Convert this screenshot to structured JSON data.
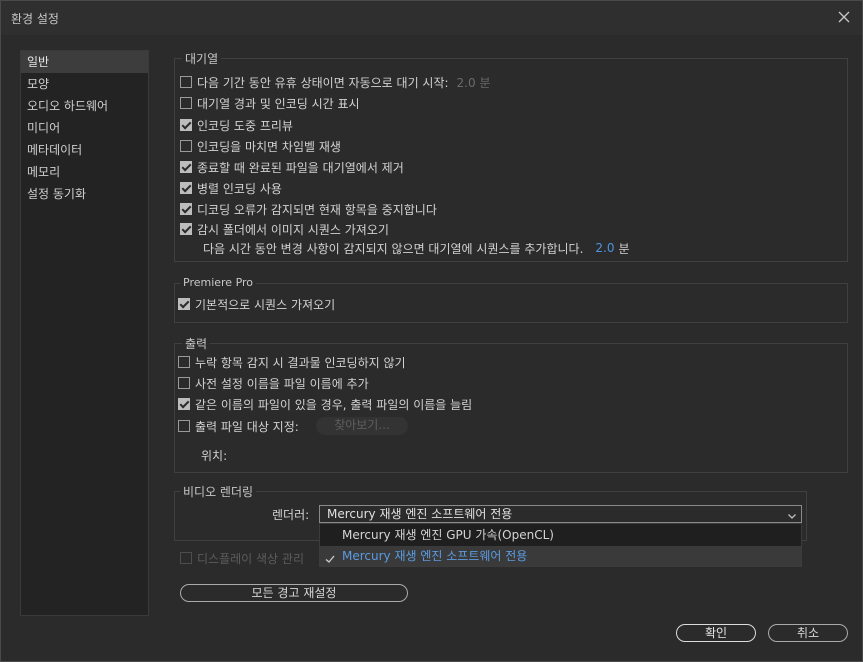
{
  "window": {
    "title": "환경 설정"
  },
  "sidebar": {
    "items": [
      {
        "label": "일반",
        "active": true
      },
      {
        "label": "모양"
      },
      {
        "label": "오디오 하드웨어"
      },
      {
        "label": "미디어"
      },
      {
        "label": "메타데이터"
      },
      {
        "label": "메모리"
      },
      {
        "label": "설정 동기화"
      }
    ]
  },
  "queue": {
    "legend": "대기열",
    "idle_label": "다음 기간 동안 유휴 상태이면 자동으로 대기 시작:",
    "idle_value": "2.0 분",
    "show_time": "대기열 경과 및 인코딩 시간 표시",
    "preview": "인코딩 도중 프리뷰",
    "chime": "인코딩을 마치면 차임벨 재생",
    "remove": "종료할 때 완료된 파일을 대기열에서 제거",
    "parallel": "병렬 인코딩 사용",
    "stop_on_error": "디코딩 오류가 감지되면 현재 항목을 중지합니다",
    "import_watch": "감시 폴더에서 이미지 시퀀스 가져오기",
    "watch_note": "다음 시간 동안 변경 사항이 감지되지 않으면 대기열에 시퀀스를 추가합니다.",
    "watch_value": "2.0",
    "watch_unit": "분"
  },
  "premiere": {
    "legend": "Premiere Pro",
    "import_seq": "기본적으로 시퀀스 가져오기"
  },
  "output": {
    "legend": "출력",
    "no_encode_missing": "누락 항목 감지 시 결과물 인코딩하지 않기",
    "append_preset": "사전 설정 이름을 파일 이름에 추가",
    "increment": "같은 이름의 파일이 있을 경우, 출력 파일의 이름을 늘림",
    "specify_dest": "출력 파일 대상 지정:",
    "browse": "찾아보기...",
    "location_label": "위치:"
  },
  "video": {
    "legend": "비디오 렌더링",
    "renderer_label": "렌더러:",
    "renderer_value": "Mercury 재생 엔진 소프트웨어 전용",
    "options": [
      "Mercury 재생 엔진 GPU 가속(OpenCL)",
      "Mercury 재생 엔진 소프트웨어 전용"
    ],
    "display_color": "디스플레이 색상 관리"
  },
  "footer": {
    "reset": "모든 경고 재설정",
    "ok": "확인",
    "cancel": "취소"
  }
}
